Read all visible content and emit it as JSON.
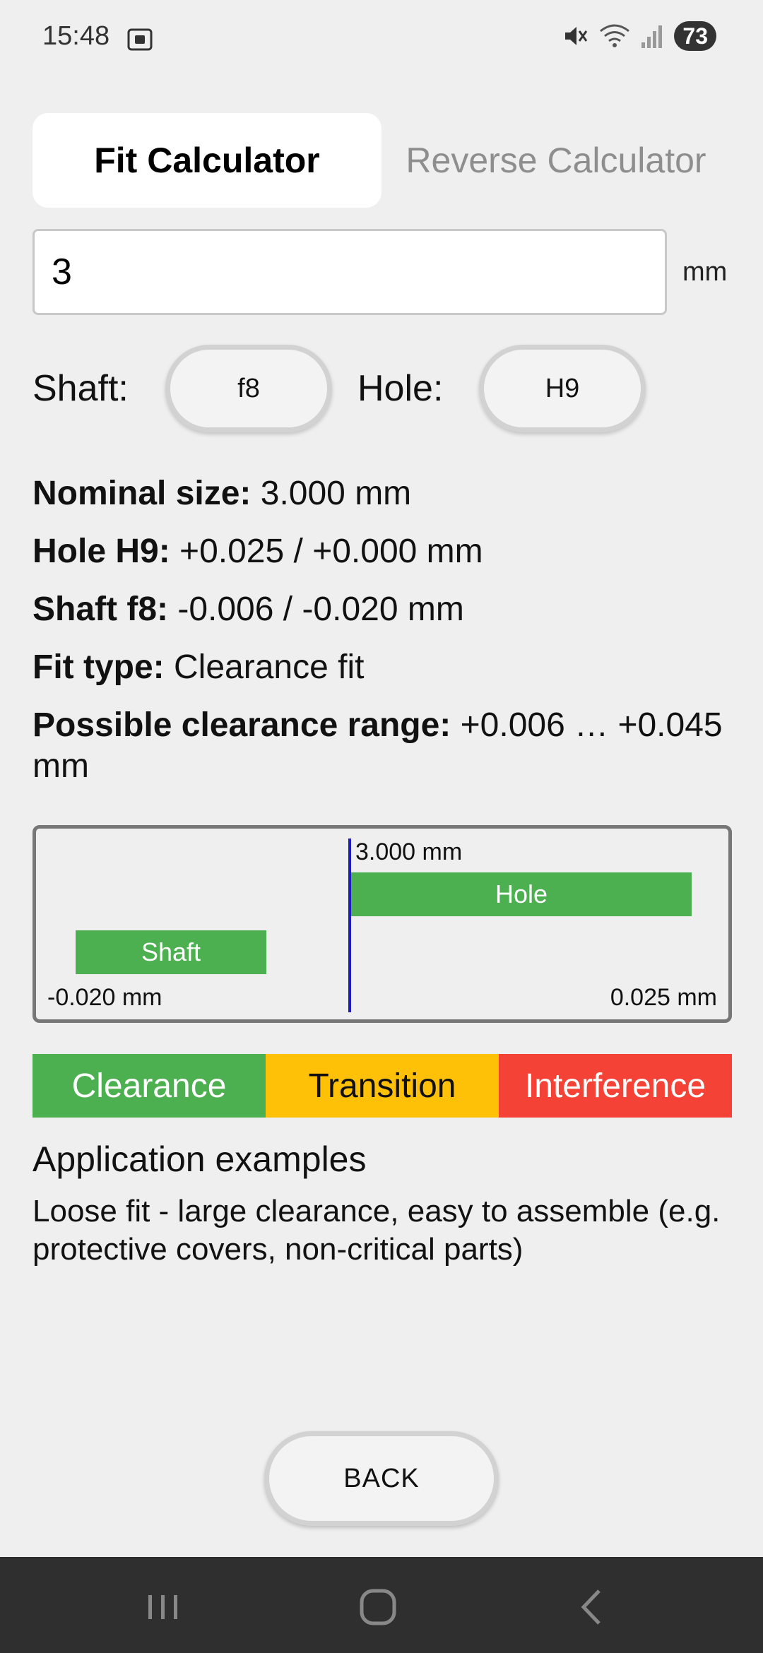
{
  "status_bar": {
    "time": "15:48",
    "battery": "73",
    "icons": [
      "screenshot-icon",
      "mute-icon",
      "wifi-icon",
      "signal-icon"
    ]
  },
  "tabs": [
    {
      "label": "Fit Calculator",
      "active": true
    },
    {
      "label": "Reverse Calculator",
      "active": false
    }
  ],
  "input": {
    "value": "3",
    "unit": "mm"
  },
  "selectors": {
    "shaft_label": "Shaft:",
    "shaft_value": "f8",
    "hole_label": "Hole:",
    "hole_value": "H9"
  },
  "results": {
    "nominal_label": "Nominal size:",
    "nominal_value": " 3.000 mm",
    "hole_label": "Hole H9:",
    "hole_value": " +0.025 / +0.000 mm",
    "shaft_label": "Shaft f8:",
    "shaft_value": " -0.006 / -0.020 mm",
    "fit_label": "Fit type:",
    "fit_value": " Clearance fit",
    "range_label": "Possible clearance range:",
    "range_value": " +0.006 … +0.045 mm"
  },
  "diagram": {
    "nominal_label": "3.000 mm",
    "hole_bar_label": "Hole",
    "shaft_bar_label": "Shaft",
    "min_label": "-0.020 mm",
    "max_label": "0.025 mm",
    "bar_color": "#4caf50",
    "zero_line_color": "#1d1dbd"
  },
  "legend": [
    {
      "label": "Clearance",
      "color": "#4caf50"
    },
    {
      "label": "Transition",
      "color": "#ffc107"
    },
    {
      "label": "Interference",
      "color": "#f44336"
    }
  ],
  "application": {
    "title": "Application examples",
    "description": "Loose fit - large clearance, easy to assemble (e.g. protective covers, non-critical parts)"
  },
  "back_button": {
    "label": "BACK"
  },
  "nav_bar": {
    "items": [
      "recents-icon",
      "home-icon",
      "back-icon"
    ]
  }
}
